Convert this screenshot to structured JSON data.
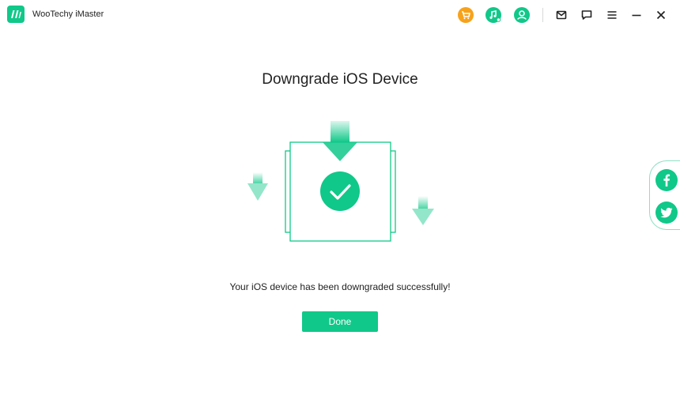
{
  "app": {
    "title": "WooTechy iMaster",
    "accent_color": "#10c889",
    "cart_color": "#f7a21b"
  },
  "titlebar_icons": [
    "cart-icon",
    "music-search-icon",
    "user-icon",
    "mail-icon",
    "feedback-icon",
    "menu-icon",
    "minimize-icon",
    "close-icon"
  ],
  "main": {
    "heading": "Downgrade iOS Device",
    "message": "Your iOS device has been downgraded successfully!",
    "done_label": "Done"
  },
  "share": {
    "icons": [
      "facebook-icon",
      "twitter-icon"
    ]
  }
}
